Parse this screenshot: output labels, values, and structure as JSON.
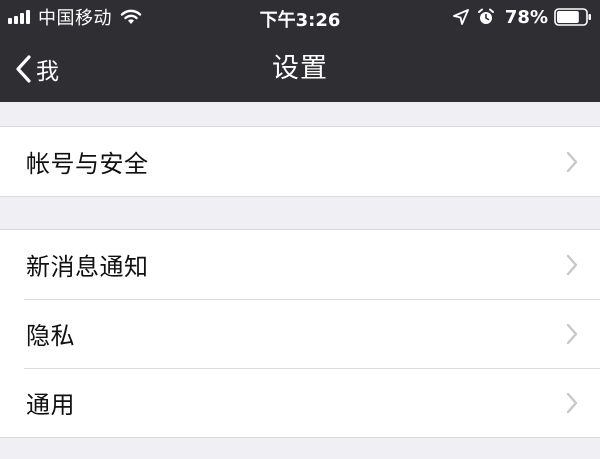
{
  "status_bar": {
    "carrier": "中国移动",
    "time": "下午3:26",
    "battery": "78%",
    "signal_icon": "signal-bars-icon",
    "wifi_icon": "wifi-icon",
    "location_icon": "location-arrow-icon",
    "alarm_icon": "alarm-clock-icon",
    "battery_level": 0.78
  },
  "nav": {
    "back_label": "我",
    "title": "设置"
  },
  "settings": {
    "group1": [
      {
        "label": "帐号与安全"
      }
    ],
    "group2": [
      {
        "label": "新消息通知"
      },
      {
        "label": "隐私"
      },
      {
        "label": "通用"
      }
    ]
  },
  "colors": {
    "header_bg": "#2e2e33",
    "page_bg": "#efeff4",
    "cell_bg": "#ffffff",
    "chevron": "#c7c7cc"
  }
}
